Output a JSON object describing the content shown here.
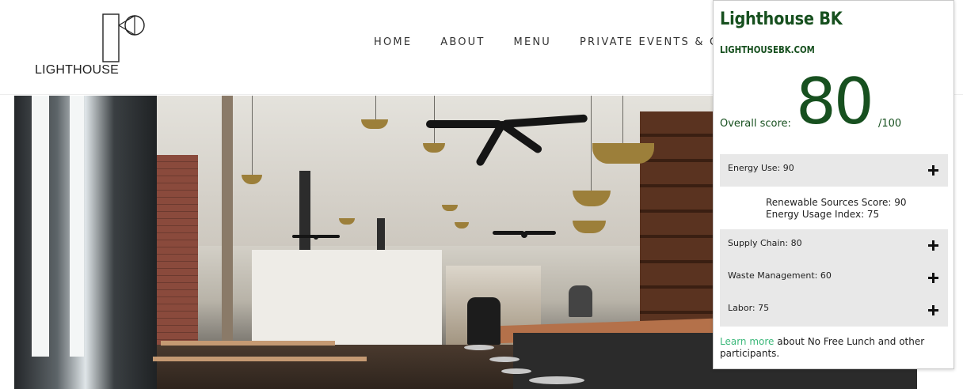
{
  "site": {
    "logo_text": "LIGHTHOUSE",
    "nav": [
      "HOME",
      "ABOUT",
      "MENU",
      "PRIVATE EVENTS & C"
    ]
  },
  "hero": {
    "description_icon": "restaurant-interior-photo"
  },
  "widget": {
    "title": "Lighthouse BK",
    "url": "LIGHTHOUSEBK.COM",
    "score_label": "Overall score:",
    "score": "80",
    "score_max": "/100",
    "categories": [
      {
        "label": "Energy Use: 90",
        "icon": "plus-icon",
        "expanded": true
      },
      {
        "label": "Supply Chain: 80",
        "icon": "plus-icon",
        "expanded": false
      },
      {
        "label": "Waste Management: 60",
        "icon": "plus-icon",
        "expanded": false
      },
      {
        "label": "Labor: 75",
        "icon": "plus-icon",
        "expanded": false
      }
    ],
    "energy_details": [
      "Renewable Sources Score: 90",
      "Energy Usage Index: 75"
    ],
    "footer_link": "Learn more",
    "footer_text": " about No Free Lunch and other participants.",
    "colors": {
      "brand_green": "#17501f",
      "link_green": "#3cb87a",
      "panel_gray": "#e8e8e8"
    }
  }
}
